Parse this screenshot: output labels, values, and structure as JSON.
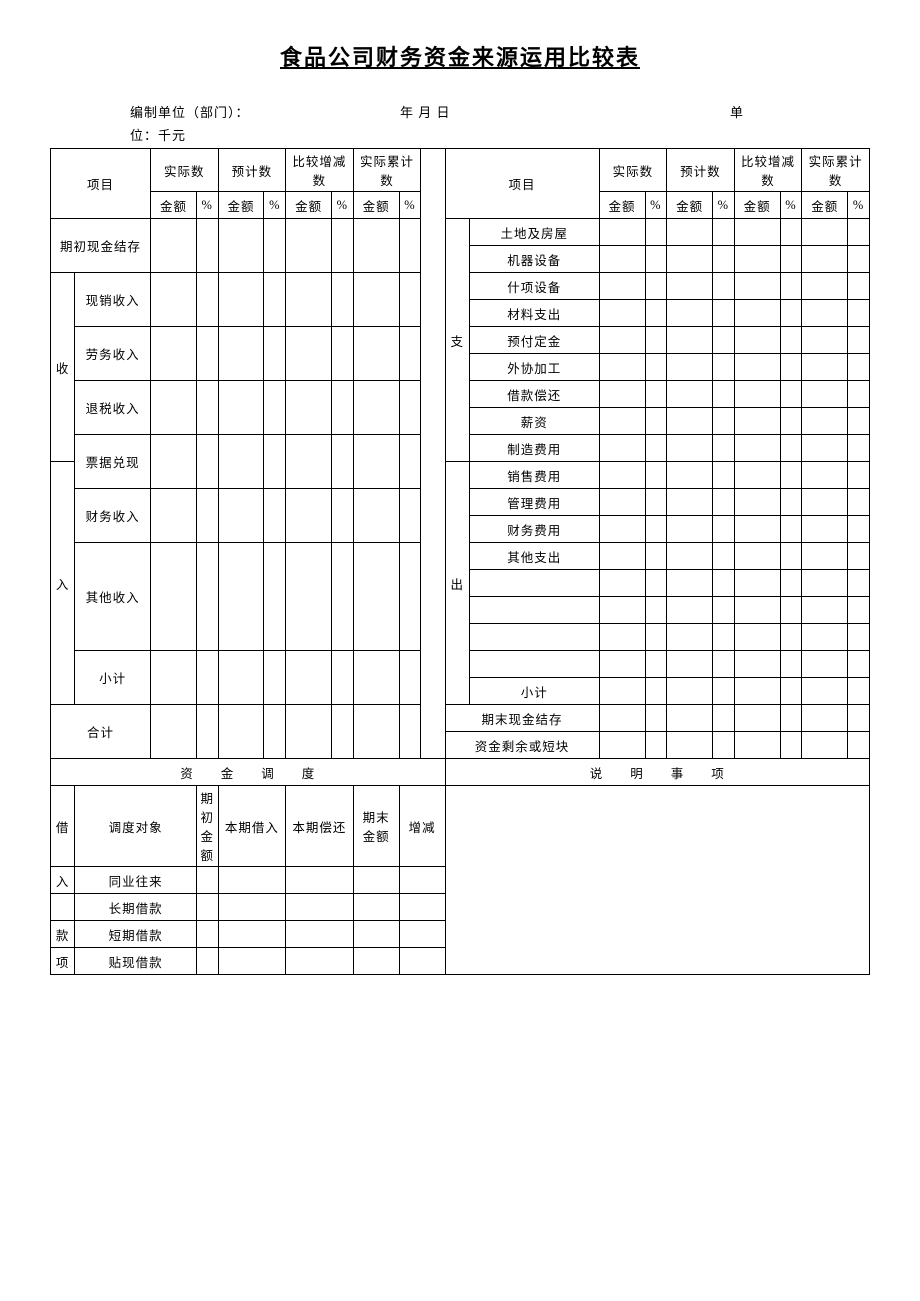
{
  "title": "食品公司财务资金来源运用比较表",
  "meta": {
    "org_label": "编制单位（部门）：",
    "date_label": "年 月 日",
    "unit_prefix": "单",
    "unit_suffix": "位：千元"
  },
  "headers": {
    "item": "项目",
    "actual": "实际数",
    "plan": "预计数",
    "diff": "比较增减数",
    "cumulative": "实际累计数",
    "diff_short": "比较增减数",
    "cumulative_short": "实际累计数",
    "amount": "金额",
    "pct": "%"
  },
  "left": {
    "opening": "期初现金结存",
    "group_top": "收",
    "group_bottom": "入",
    "rows": [
      "现销收入",
      "劳务收入",
      "退税收入",
      "票据兑现",
      "财务收入",
      "其他收入",
      "小计"
    ],
    "total": "合计"
  },
  "right": {
    "group_top": "支",
    "group_bottom": "出",
    "rows": [
      "土地及房屋",
      "机器设备",
      "什项设备",
      "材料支出",
      "预付定金",
      "外协加工",
      "借款偿还",
      "薪资",
      "制造费用",
      "销售费用",
      "管理费用",
      "财务费用",
      "其他支出"
    ],
    "subtotal": "小计",
    "closing": "期末现金结存",
    "shortfall": "资金剩余或短块"
  },
  "lower": {
    "fund_alloc": "资　　金　　调　　度",
    "notes": "说　　明　　事　　项",
    "group1": "借",
    "group2": "入",
    "group3": "款",
    "group4": "项",
    "h_target": "调度对象",
    "h_opening": "期初金额",
    "h_borrow": "本期借入",
    "h_repay": "本期偿还",
    "h_closing": "期末金额",
    "h_change": "增减",
    "rows": [
      "同业往来",
      "长期借款",
      "短期借款",
      "贴现借款"
    ]
  }
}
